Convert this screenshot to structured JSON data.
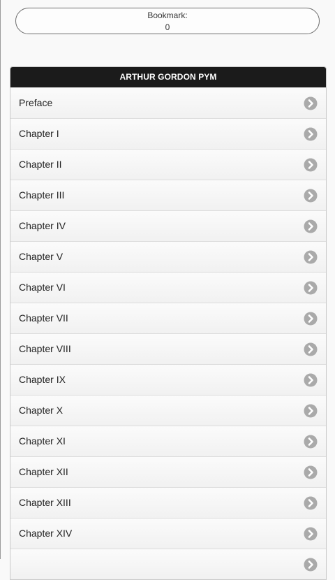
{
  "bookmark": {
    "label": "Bookmark:",
    "value": "0"
  },
  "list": {
    "title": "ARTHUR GORDON PYM",
    "items": [
      {
        "label": "Preface"
      },
      {
        "label": "Chapter I"
      },
      {
        "label": "Chapter II"
      },
      {
        "label": "Chapter III"
      },
      {
        "label": "Chapter IV"
      },
      {
        "label": "Chapter V"
      },
      {
        "label": "Chapter VI"
      },
      {
        "label": "Chapter VII"
      },
      {
        "label": "Chapter VIII"
      },
      {
        "label": "Chapter IX"
      },
      {
        "label": "Chapter X"
      },
      {
        "label": "Chapter XI"
      },
      {
        "label": "Chapter XII"
      },
      {
        "label": "Chapter XIII"
      },
      {
        "label": "Chapter XIV"
      },
      {
        "label": ""
      }
    ],
    "item_icon": "chevron-right-circle-icon"
  },
  "colors": {
    "header_bg": "#1b1b1b",
    "header_text": "#ffffff",
    "icon": "#aaaaaa"
  }
}
